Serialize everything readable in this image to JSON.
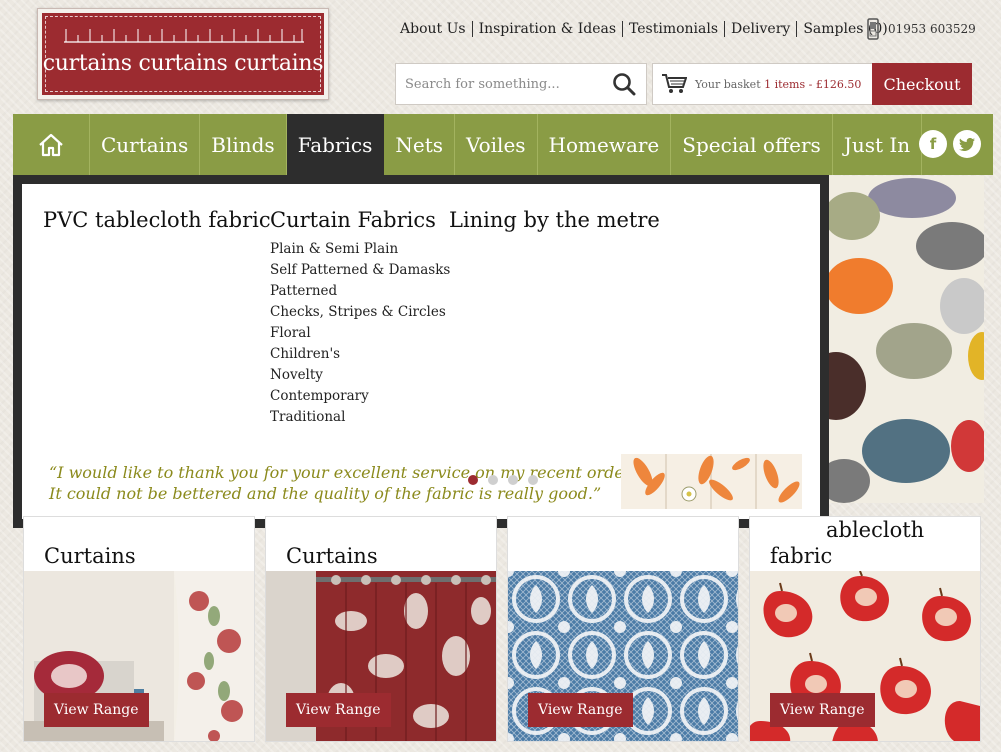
{
  "brand": {
    "logo_text": "curtains curtains curtains",
    "accent": "#9c2b30",
    "nav_color": "#8a9c45"
  },
  "top_links": [
    "About Us",
    "Inspiration & Ideas",
    "Testimonials",
    "Delivery",
    "Samples (0)"
  ],
  "phone": {
    "icon": "phone-icon",
    "number": "01953 603529"
  },
  "search": {
    "placeholder": "Search for something...",
    "icon": "search-icon"
  },
  "basket": {
    "icon": "cart-icon",
    "label": "Your basket",
    "value": "1 items - £126.50",
    "checkout": "Checkout"
  },
  "nav": {
    "home_icon": "home-icon",
    "items": [
      "Curtains",
      "Blinds",
      "Fabrics",
      "Nets",
      "Voiles",
      "Homeware",
      "Special offers",
      "Just In"
    ],
    "active": "Fabrics",
    "social": {
      "facebook": "f",
      "twitter": "t"
    }
  },
  "mega_menu": {
    "col1_title": "PVC tablecloth fabric",
    "col2_title": "Curtain Fabrics",
    "col2_items": [
      "Plain & Semi Plain",
      "Self Patterned & Damasks",
      "Patterned",
      "Checks, Stripes & Circles",
      "Floral",
      "Children's",
      "Novelty",
      "Contemporary",
      "Traditional"
    ],
    "col3_title": "Lining by the metre",
    "quote_line1": "“I would like to thank you for your excellent service on my recent order.",
    "quote_line2": "It could not be bettered and the quality of the  fabric is really good.”",
    "slider_active": 1,
    "slider_count": 4
  },
  "cards": [
    {
      "title": "Curtains",
      "button": "View Range"
    },
    {
      "title": "Curtains",
      "button": "View Range"
    },
    {
      "title": "",
      "button": "View Range"
    },
    {
      "title_line1": "ablecloth",
      "title_line2": "fabric",
      "button": "View Range"
    }
  ]
}
